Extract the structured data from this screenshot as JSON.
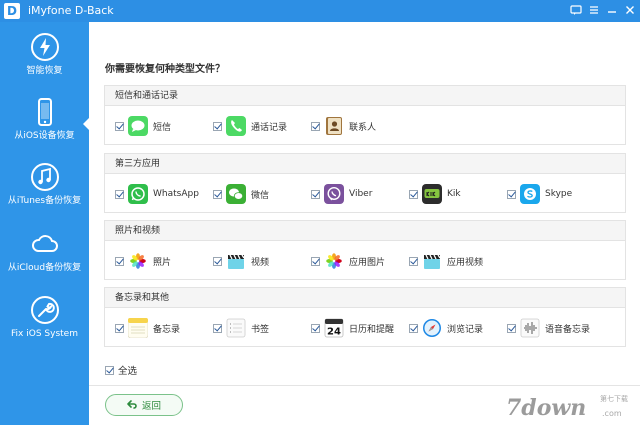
{
  "window": {
    "title": "iMyfone D-Back",
    "logo_letter": "D"
  },
  "sidebar": {
    "items": [
      {
        "label": "智能恢复",
        "icon": "lightning-icon"
      },
      {
        "label": "从iOS设备恢复",
        "icon": "iphone-icon",
        "selected": true
      },
      {
        "label": "从iTunes备份恢复",
        "icon": "music-note-icon"
      },
      {
        "label": "从iCloud备份恢复",
        "icon": "cloud-icon"
      },
      {
        "label": "Fix iOS System",
        "icon": "wrench-icon"
      }
    ]
  },
  "main": {
    "question": "你需要恢复何种类型文件？",
    "groups": [
      {
        "title": "短信和通话记录",
        "items": [
          {
            "label": "短信",
            "icon": "messages-icon",
            "checked": true
          },
          {
            "label": "通话记录",
            "icon": "phone-icon",
            "checked": true
          },
          {
            "label": "联系人",
            "icon": "contacts-icon",
            "checked": true
          }
        ]
      },
      {
        "title": "第三方应用",
        "items": [
          {
            "label": "WhatsApp",
            "icon": "whatsapp-icon",
            "checked": true
          },
          {
            "label": "微信",
            "icon": "wechat-icon",
            "checked": true
          },
          {
            "label": "Viber",
            "icon": "viber-icon",
            "checked": true
          },
          {
            "label": "Kik",
            "icon": "kik-icon",
            "checked": true
          },
          {
            "label": "Skype",
            "icon": "skype-icon",
            "checked": true
          }
        ]
      },
      {
        "title": "照片和视频",
        "items": [
          {
            "label": "照片",
            "icon": "photos-icon",
            "checked": true
          },
          {
            "label": "视频",
            "icon": "clapperboard-icon",
            "checked": true
          },
          {
            "label": "应用图片",
            "icon": "app-photos-icon",
            "checked": true
          },
          {
            "label": "应用视频",
            "icon": "app-video-icon",
            "checked": true
          }
        ]
      },
      {
        "title": "备忘录和其他",
        "items": [
          {
            "label": "备忘录",
            "icon": "notes-icon",
            "checked": true
          },
          {
            "label": "书签",
            "icon": "bookmark-icon",
            "checked": true
          },
          {
            "label": "日历和提醒",
            "icon": "calendar-icon",
            "checked": true,
            "calendar_day": "24"
          },
          {
            "label": "浏览记录",
            "icon": "safari-icon",
            "checked": true
          },
          {
            "label": "语音备忘录",
            "icon": "voice-memo-icon",
            "checked": true
          }
        ]
      }
    ],
    "select_all": {
      "label": "全选",
      "checked": true
    },
    "back_button": {
      "label": "返回"
    }
  },
  "watermark": {
    "main": "7down",
    "domain": ".com",
    "cn": "第七下载"
  },
  "colors": {
    "titlebar": "#2d8fe4",
    "sidebar": "#2f95e8",
    "back_button_text": "#2e8b3e"
  }
}
